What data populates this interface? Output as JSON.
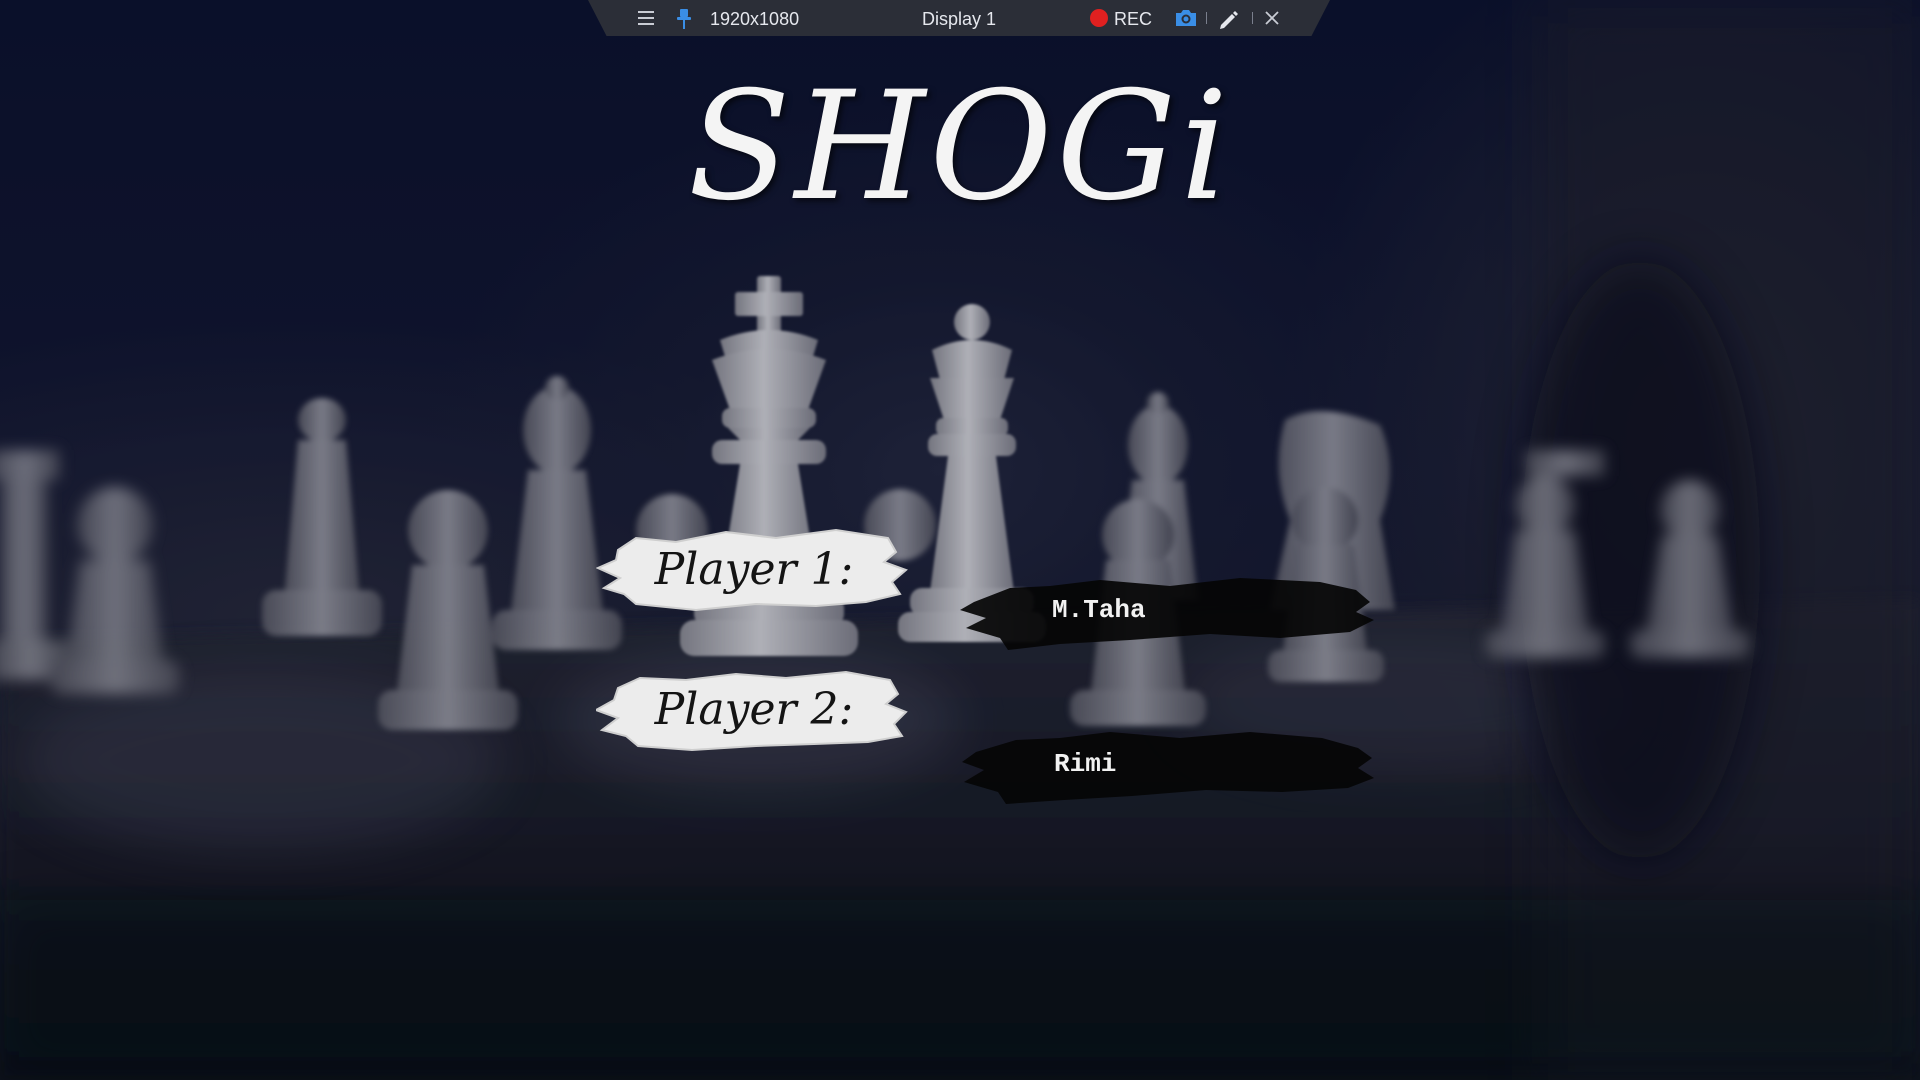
{
  "toolbar": {
    "menu_icon": "hamburger-menu-icon",
    "pin_icon": "pin-icon",
    "resolution": "1920x1080",
    "display_name": "Display 1",
    "rec_label": "REC",
    "rec_color": "#e02020",
    "camera_icon": "camera-icon",
    "pen_icon": "pen-icon",
    "close_icon": "close-icon",
    "accent_color": "#3a8ee6"
  },
  "game": {
    "title": "SHOGi",
    "background": "blurred chess pieces on a chessboard",
    "players": [
      {
        "label": "Player 1:",
        "name": "M.Taha"
      },
      {
        "label": "Player 2:",
        "name": "Rimi"
      }
    ]
  }
}
